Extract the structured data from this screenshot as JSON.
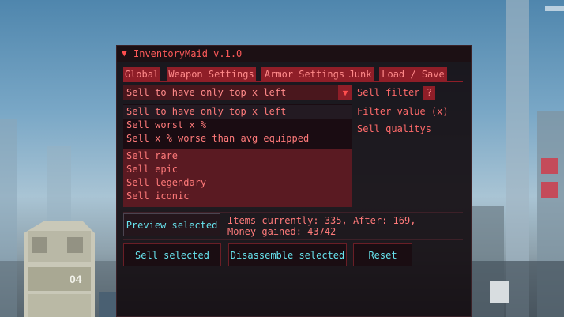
{
  "window": {
    "title": "InventoryMaid v.1.0",
    "collapse_icon": "triangle-down-icon"
  },
  "tabs": [
    {
      "label": "Global"
    },
    {
      "label": "Weapon Settings"
    },
    {
      "label": "Armor Settings"
    },
    {
      "label": "Junk"
    },
    {
      "label": "Load / Save"
    }
  ],
  "sell_filter": {
    "selected_value": "Sell to have only top x left",
    "label": "Sell filter",
    "help_label": "?",
    "options": [
      "Sell to have only top x left",
      "Sell worst x %",
      "Sell x % worse than avg equipped"
    ]
  },
  "filter_value": {
    "label": "Filter value (x)"
  },
  "qualities": {
    "label": "Sell qualitys",
    "items": [
      "Sell rare",
      "Sell epic",
      "Sell legendary",
      "Sell iconic"
    ]
  },
  "actions": {
    "preview_label": "Preview selected",
    "sell_label": "Sell selected",
    "disassemble_label": "Disassemble selected",
    "reset_label": "Reset"
  },
  "status": {
    "line1": "Items currently: 335, After: 169,",
    "line2": "Money gained: 43742"
  },
  "background": {
    "billboard_number": "04"
  },
  "colors": {
    "accent_red": "#ff5a5a",
    "tab_bg": "#8f1e28",
    "button_text_cyan": "#67e3ee",
    "window_bg": "#140e12"
  }
}
